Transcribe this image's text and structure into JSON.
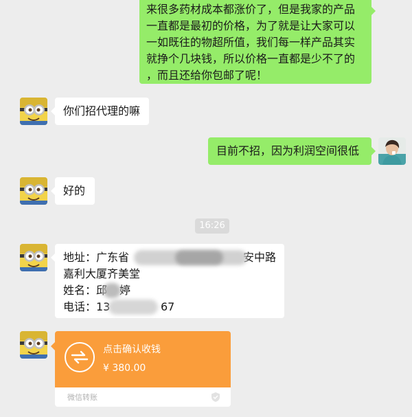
{
  "messages": {
    "m1": {
      "lines": [
        "来很多药材成本都涨价了，但是我家的产品",
        "一直都是最初的价格，为了就是让大家可以",
        "一如既往的物超所值，我们每一样产品其实",
        "就挣个几块钱，所以价格一直都是少不了的",
        "，而且还给你包邮了呢！"
      ]
    },
    "m2": {
      "text": "你们招代理的嘛"
    },
    "m3": {
      "text": "目前不招，因为利润空间很低"
    },
    "m4": {
      "text": "好的"
    },
    "time": "16:26",
    "address": {
      "line1_prefix": "地址：广东省",
      "line1_suffix": "安中路",
      "line2": "嘉利大厦齐美堂",
      "line3_prefix": "姓名：邱",
      "line3_suffix": "婷",
      "line4_prefix": "电话：13",
      "line4_suffix": "67"
    },
    "transfer": {
      "title": "点击确认收钱",
      "amount": "¥ 380.00",
      "label": "微信转账"
    }
  },
  "colors": {
    "background": "#ededed",
    "sent_bubble": "#95ec69",
    "received_bubble": "#ffffff",
    "transfer": "#fa9d3b"
  }
}
